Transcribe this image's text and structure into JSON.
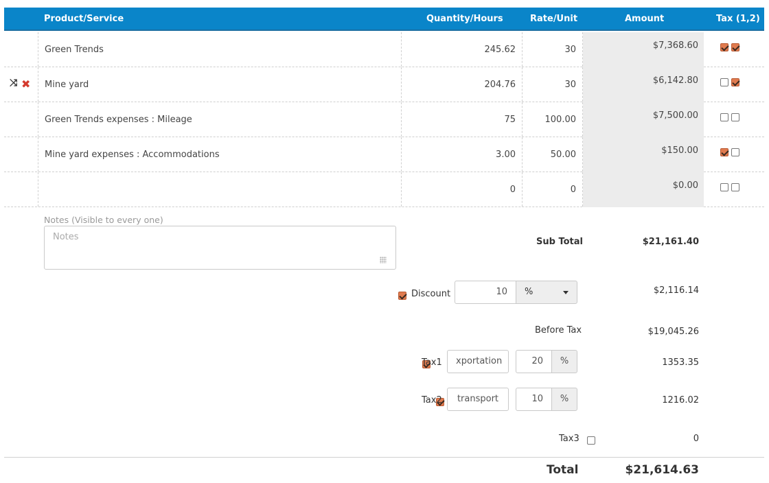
{
  "header": {
    "product": "Product/Service",
    "quantity": "Quantity/Hours",
    "rate": "Rate/Unit",
    "amount": "Amount",
    "tax": "Tax (1,2)"
  },
  "rows": [
    {
      "product": "Green Trends",
      "quantity": "245.62",
      "rate": "30",
      "amount": "$7,368.60",
      "tax1": true,
      "tax2": true
    },
    {
      "product": "Mine yard",
      "quantity": "204.76",
      "rate": "30",
      "amount": "$6,142.80",
      "tax1": false,
      "tax2": true
    },
    {
      "product": "Green Trends expenses : Mileage",
      "quantity": "75",
      "rate": "100.00",
      "amount": "$7,500.00",
      "tax1": false,
      "tax2": false
    },
    {
      "product": "Mine yard  expenses : Accommodations",
      "quantity": "3.00",
      "rate": "50.00",
      "amount": "$150.00",
      "tax1": true,
      "tax2": false
    },
    {
      "product": "",
      "quantity": "0",
      "rate": "0",
      "amount": "$0.00",
      "tax1": false,
      "tax2": false
    }
  ],
  "row_icons": [
    "shuffle-icon",
    "delete-icon"
  ],
  "notes": {
    "label": "Notes (Visible to every one)",
    "placeholder": "Notes"
  },
  "summary": {
    "subtotal_label": "Sub Total",
    "subtotal_value": "$21,161.40",
    "discount_label": "Discount",
    "discount_checked": true,
    "discount_input": "10",
    "discount_unit": "%",
    "discount_value": "$2,116.14",
    "before_tax_label": "Before Tax",
    "before_tax_value": "$19,045.26",
    "tax1_label": "Tax1",
    "tax1_checked": true,
    "tax1_name": "xportation",
    "tax1_rate": "20",
    "tax1_unit": "%",
    "tax1_value": "1353.35",
    "tax2_label": "Tax2",
    "tax2_checked": true,
    "tax2_name": "transport",
    "tax2_rate": "10",
    "tax2_unit": "%",
    "tax2_value": "1216.02",
    "tax3_label": "Tax3",
    "tax3_checked": false,
    "tax3_value": "0",
    "total_label": "Total",
    "total_value": "$21,614.63"
  },
  "colors": {
    "header": "#0a85c9",
    "checkbox_on": "#e07b4f",
    "delete": "#d43a2e",
    "amount_bg": "#ececec"
  }
}
